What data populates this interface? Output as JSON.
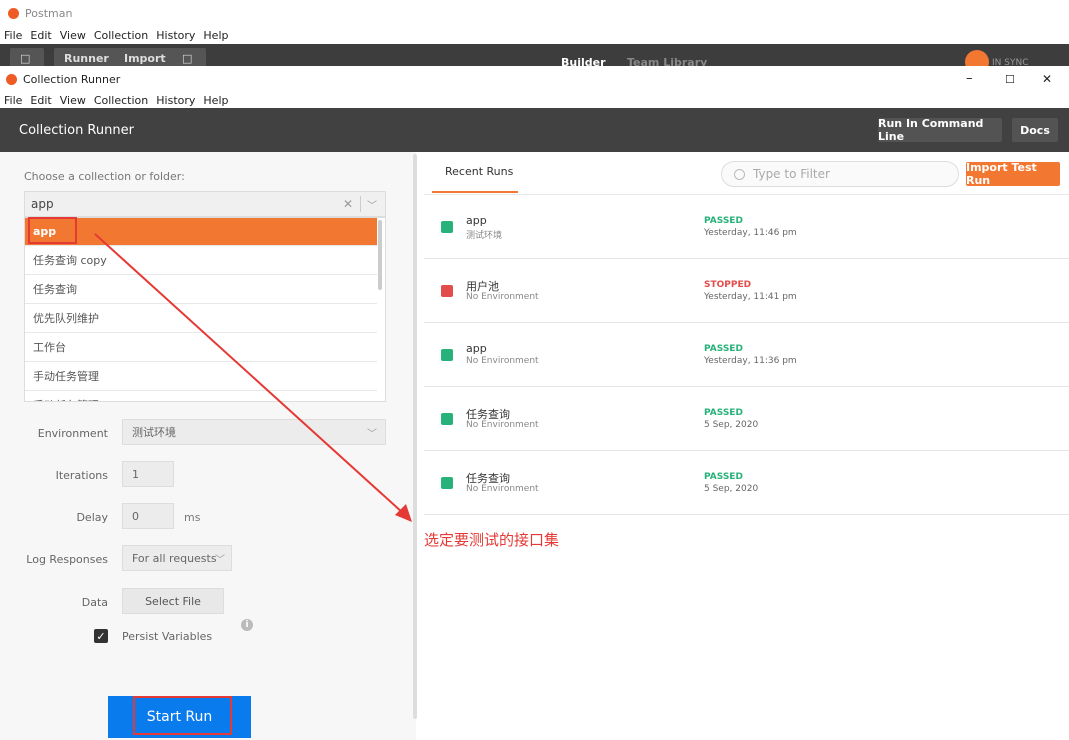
{
  "bg_window": {
    "title": "Postman",
    "menu": [
      "File",
      "Edit",
      "View",
      "Collection",
      "History",
      "Help"
    ],
    "toolbar": {
      "runner": "Runner",
      "import": "Import",
      "builder": "Builder",
      "team_library": "Team Library",
      "sync": "IN SYNC"
    }
  },
  "runner": {
    "window_title": "Collection Runner",
    "window_controls": {
      "minimize": "–",
      "maximize": "☐",
      "close": "✕"
    },
    "menu": [
      "File",
      "Edit",
      "View",
      "Collection",
      "History",
      "Help"
    ],
    "header": {
      "title": "Collection Runner",
      "run_cmd_label": "Run In Command Line",
      "docs_label": "Docs"
    },
    "left": {
      "choose_label": "Choose a collection or folder:",
      "selected_value": "app",
      "options": [
        "app",
        "任务查询 copy",
        "任务查询",
        "优先队列维护",
        "工作台",
        "手动任务管理",
        "手动任务管理"
      ],
      "environment": {
        "label": "Environment",
        "value": "测试环境"
      },
      "iterations": {
        "label": "Iterations",
        "value": "1"
      },
      "delay": {
        "label": "Delay",
        "value": "0",
        "unit": "ms"
      },
      "log_responses": {
        "label": "Log Responses",
        "value": "For all requests"
      },
      "data": {
        "label": "Data",
        "button": "Select File"
      },
      "persist": {
        "label": "Persist Variables",
        "checked": true
      },
      "start_label": "Start Run"
    },
    "right": {
      "tab": "Recent Runs",
      "filter_placeholder": "Type to Filter",
      "import_label": "Import Test Run",
      "runs": [
        {
          "name": "app",
          "env": "测试环境",
          "status": "PASSED",
          "time": "Yesterday, 11:46 pm",
          "color": "#27b17b"
        },
        {
          "name": "用户池",
          "env": "No Environment",
          "status": "STOPPED",
          "time": "Yesterday, 11:41 pm",
          "color": "#e34c4c"
        },
        {
          "name": "app",
          "env": "No Environment",
          "status": "PASSED",
          "time": "Yesterday, 11:36 pm",
          "color": "#27b17b"
        },
        {
          "name": "任务查询",
          "env": "No Environment",
          "status": "PASSED",
          "time": "5 Sep, 2020",
          "color": "#27b17b"
        },
        {
          "name": "任务查询",
          "env": "No Environment",
          "status": "PASSED",
          "time": "5 Sep, 2020",
          "color": "#27b17b"
        }
      ]
    }
  },
  "annotation": {
    "text": "选定要测试的接口集",
    "color": "#e53935"
  },
  "colors": {
    "accent": "#f27831",
    "primary": "#097bed",
    "header": "#414141",
    "passed": "#27b17b",
    "stopped": "#e34c4c"
  }
}
